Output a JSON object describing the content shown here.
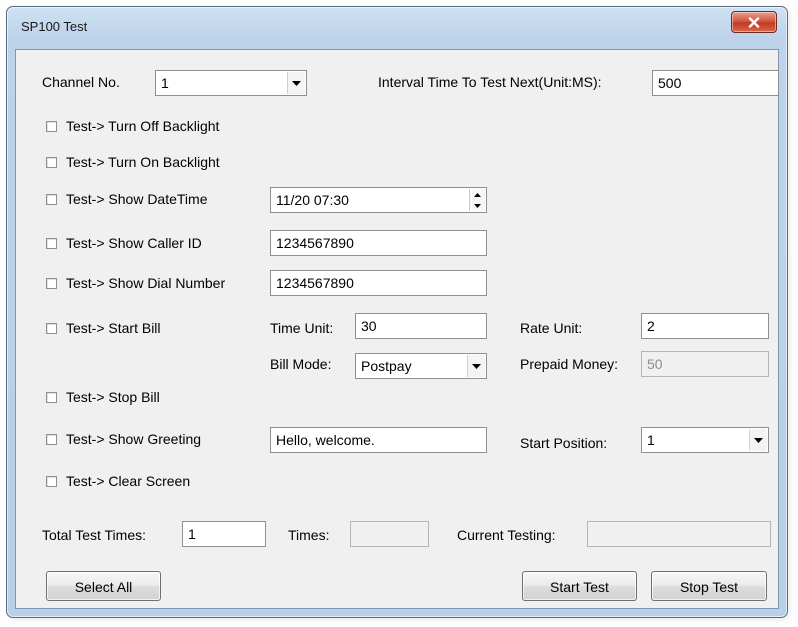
{
  "window": {
    "title": "SP100 Test"
  },
  "channel": {
    "label": "Channel No.",
    "value": "1"
  },
  "interval": {
    "label": "Interval Time To Test Next(Unit:MS):",
    "value": "500"
  },
  "tests": {
    "backlight_off": "Test-> Turn Off Backlight",
    "backlight_on": "Test-> Turn On Backlight",
    "show_datetime": "Test-> Show DateTime",
    "show_caller_id": "Test-> Show Caller ID",
    "show_dial_number": "Test-> Show Dial Number",
    "start_bill": "Test-> Start Bill",
    "stop_bill": "Test-> Stop Bill",
    "show_greeting": "Test-> Show Greeting",
    "clear_screen": "Test-> Clear Screen"
  },
  "datetime": {
    "value": "11/20 07:30"
  },
  "caller_id": {
    "value": "1234567890"
  },
  "dial_number": {
    "value": "1234567890"
  },
  "bill": {
    "time_unit_label": "Time Unit:",
    "time_unit_value": "30",
    "rate_unit_label": "Rate Unit:",
    "rate_unit_value": "2",
    "bill_mode_label": "Bill Mode:",
    "bill_mode_value": "Postpay",
    "prepaid_label": "Prepaid Money:",
    "prepaid_value": "50"
  },
  "greeting": {
    "value": "Hello, welcome.",
    "start_position_label": "Start Position:",
    "start_position_value": "1"
  },
  "footer": {
    "total_label": "Total Test Times:",
    "total_value": "1",
    "times_label": "Times:",
    "times_value": "",
    "current_label": "Current Testing:",
    "current_value": ""
  },
  "buttons": {
    "select_all": "Select All",
    "start_test": "Start Test",
    "stop_test": "Stop Test"
  },
  "icons": {
    "close": "close-icon",
    "dropdown": "chevron-down-icon",
    "spin_up": "spin-up-icon",
    "spin_down": "spin-down-icon"
  },
  "colors": {
    "titlebar": "#bdd3ea",
    "client": "#f0f0f0",
    "close_button": "#c23a22",
    "disabled_text": "#8d8d8d"
  }
}
